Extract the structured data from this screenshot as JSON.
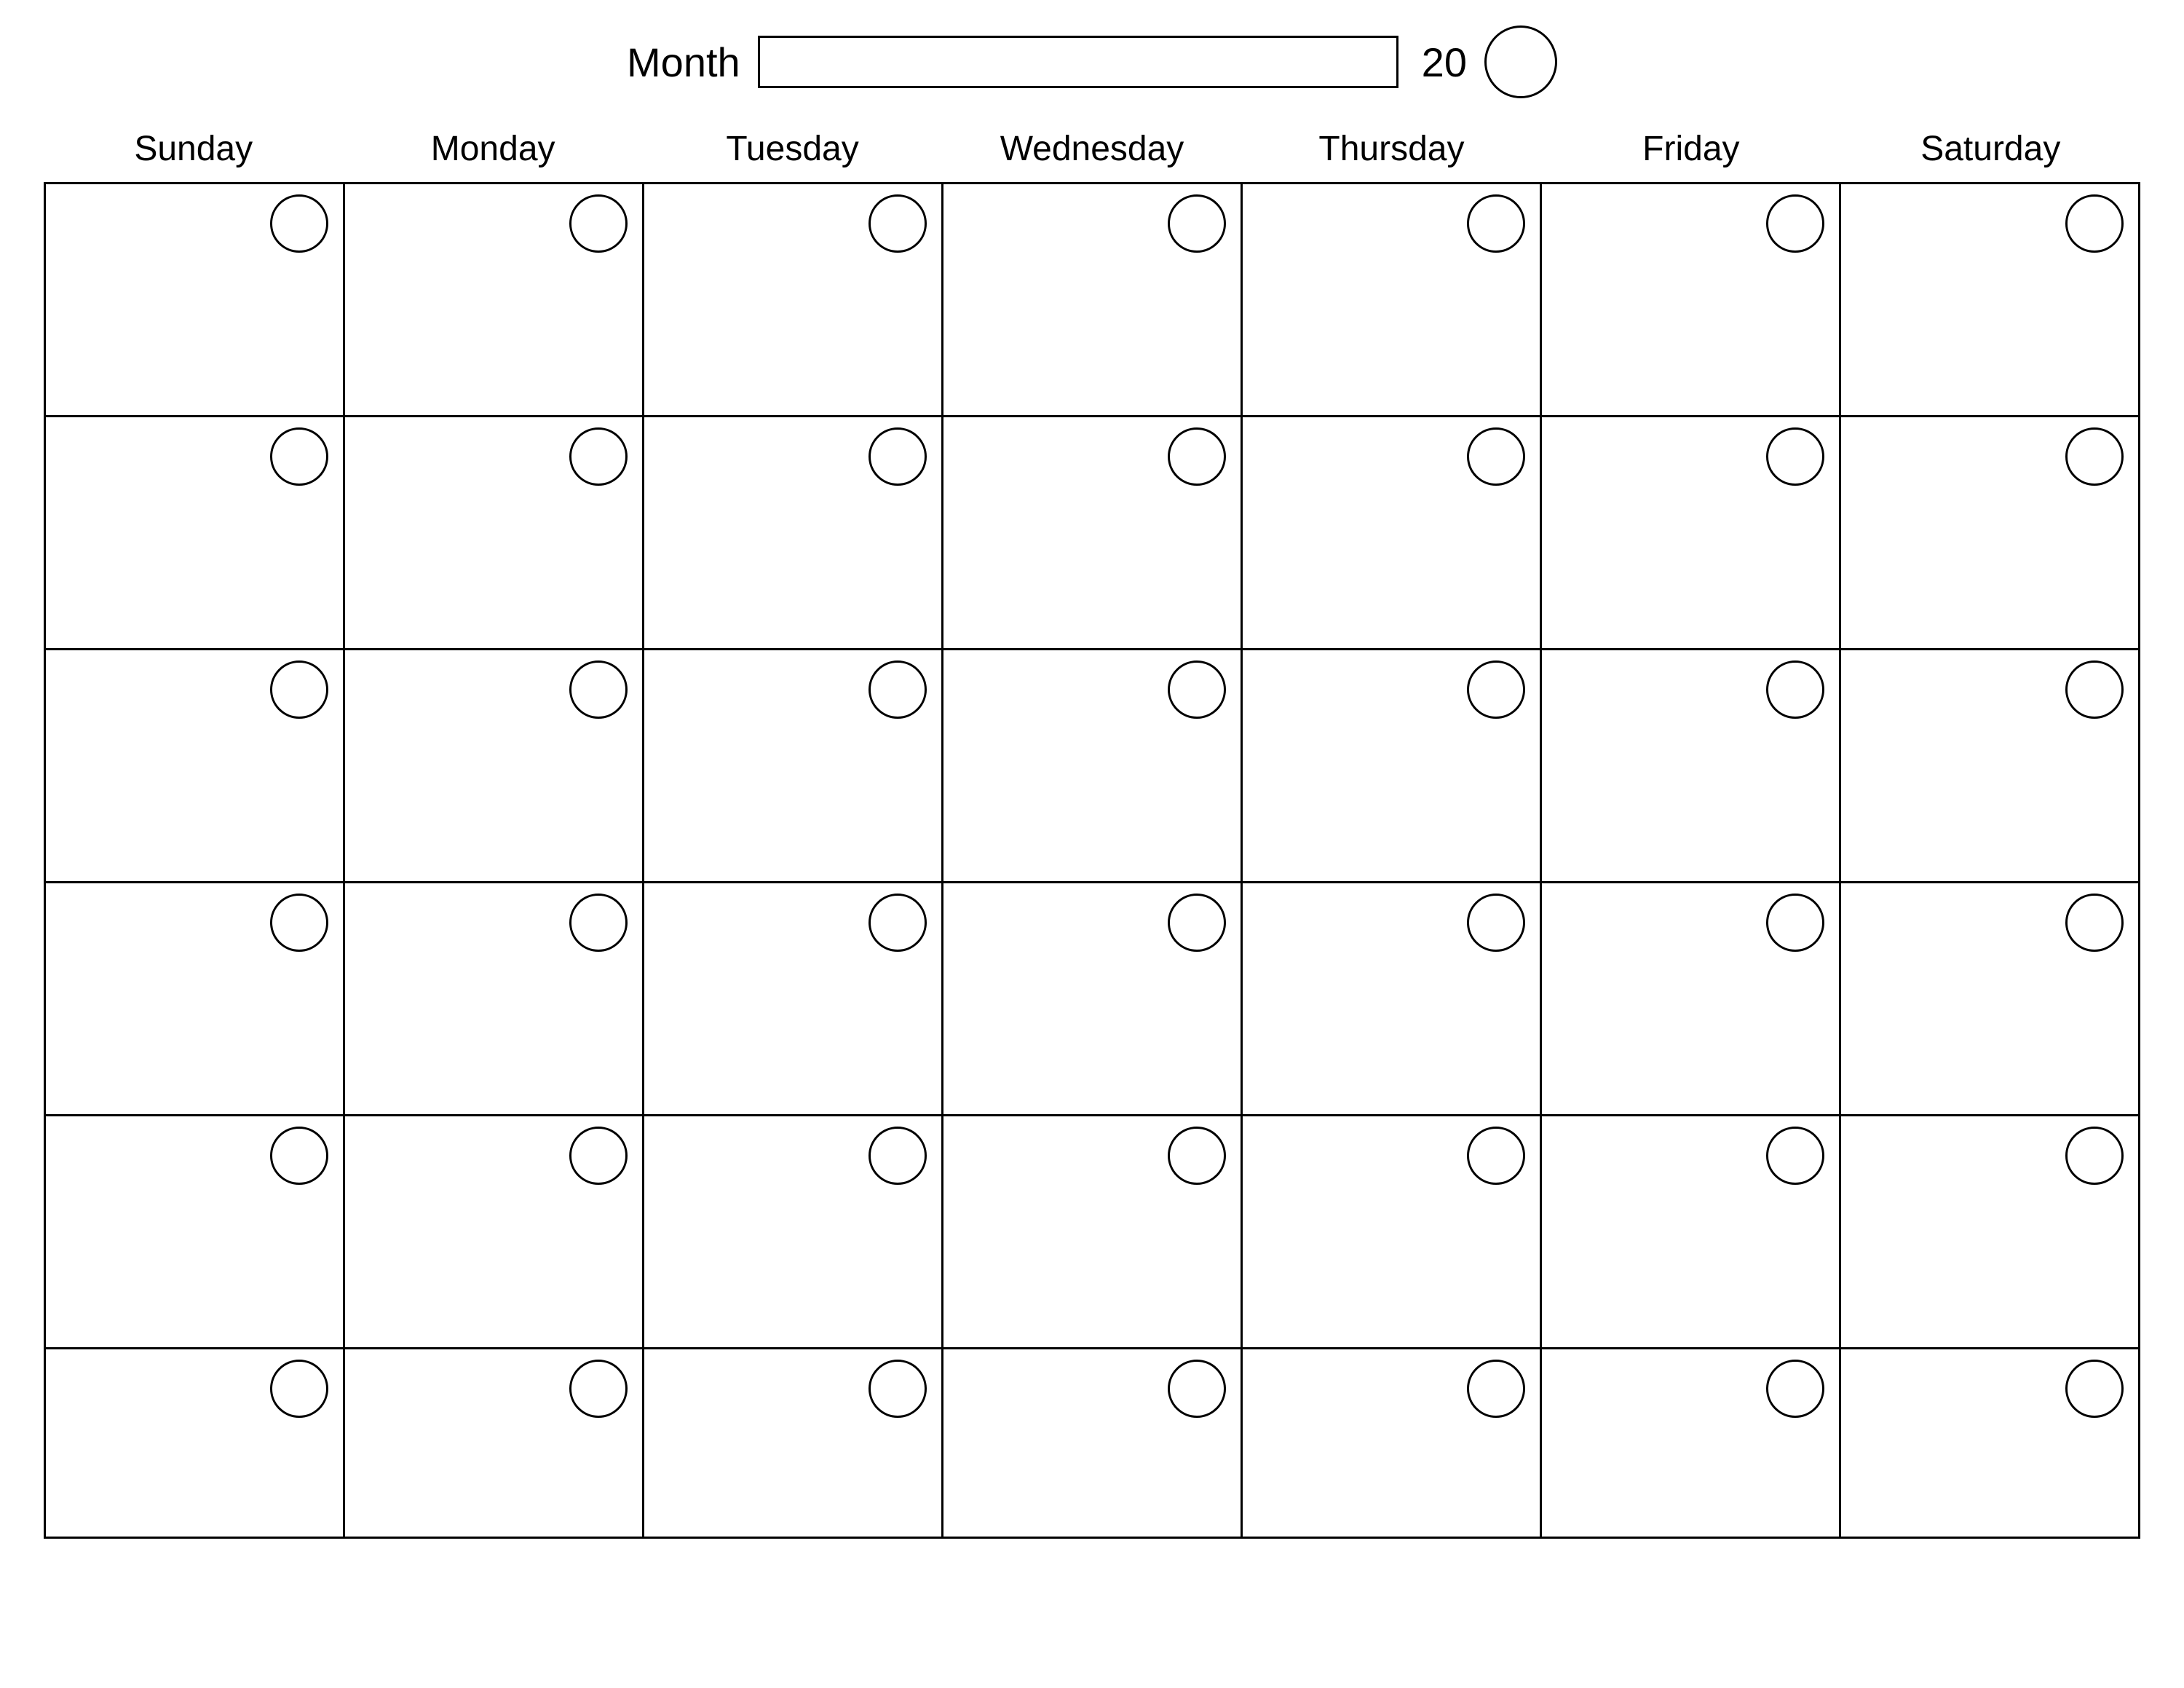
{
  "header": {
    "month_label": "Month",
    "month_value": "",
    "year_prefix": "20",
    "year_value": ""
  },
  "weekdays": [
    "Sunday",
    "Monday",
    "Tuesday",
    "Wednesday",
    "Thursday",
    "Friday",
    "Saturday"
  ],
  "rows": 6,
  "cols": 7
}
